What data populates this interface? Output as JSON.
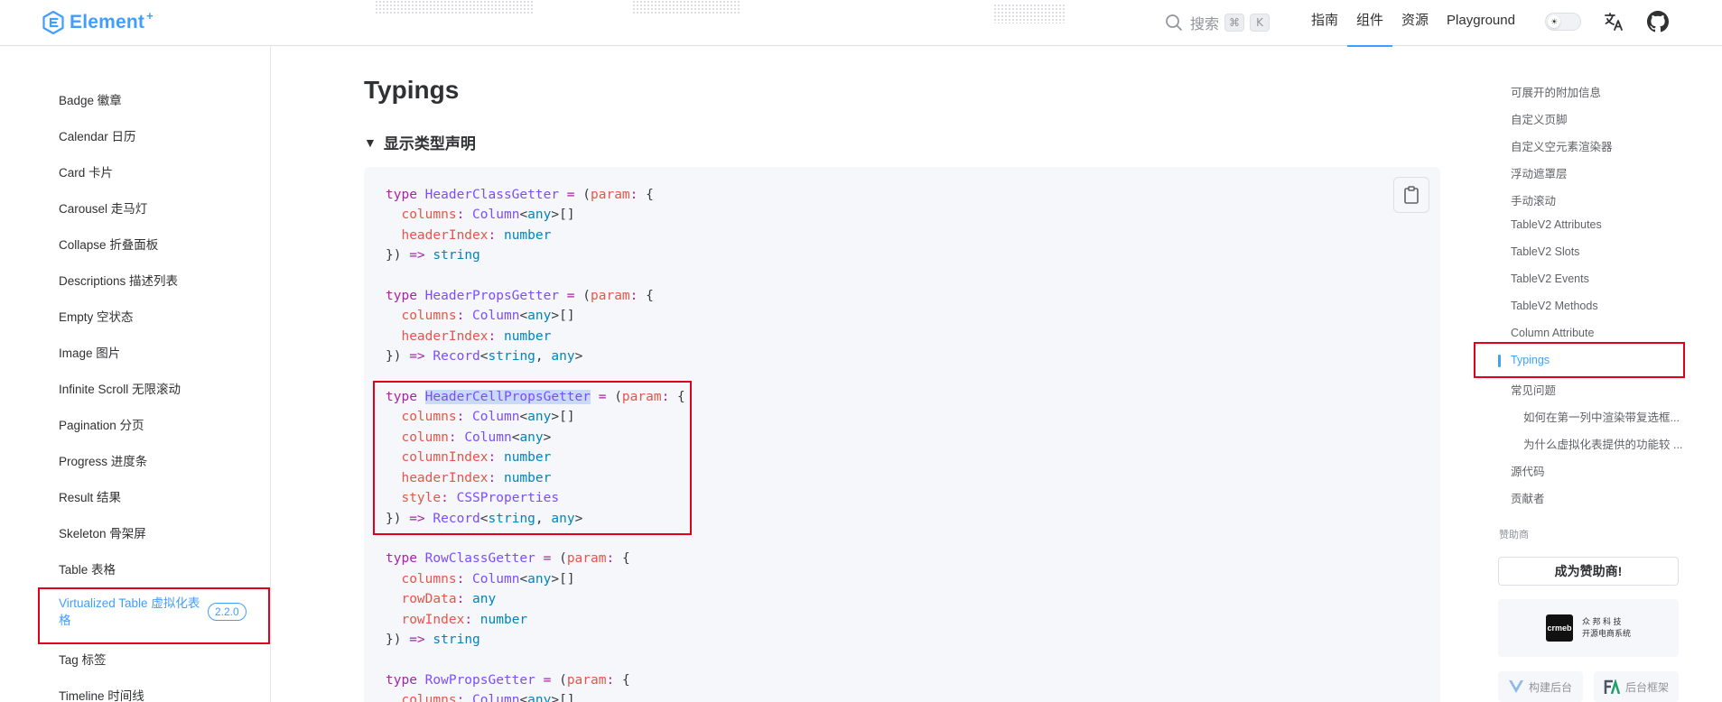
{
  "header": {
    "brand": "Element",
    "brand_plus": "+",
    "search_placeholder": "搜索",
    "kbd_cmd": "⌘",
    "kbd_k": "K",
    "nav": [
      "指南",
      "组件",
      "资源",
      "Playground"
    ],
    "nav_active_index": 1
  },
  "sidebar": {
    "items": [
      "Badge 徽章",
      "Calendar 日历",
      "Card 卡片",
      "Carousel 走马灯",
      "Collapse 折叠面板",
      "Descriptions 描述列表",
      "Empty 空状态",
      "Image 图片",
      "Infinite Scroll 无限滚动",
      "Pagination 分页",
      "Progress 进度条",
      "Result 结果",
      "Skeleton 骨架屏",
      "Table 表格",
      "Virtualized Table 虚拟化表格",
      "Tag 标签",
      "Timeline 时间线"
    ],
    "active_item": "Virtualized Table 虚拟化表格",
    "active_badge": "2.2.0"
  },
  "main": {
    "title": "Typings",
    "summary": "显示类型声明"
  },
  "toc": {
    "items": [
      "可展开的附加信息",
      "自定义页脚",
      "自定义空元素渲染器",
      "浮动遮罩层",
      "手动滚动",
      "TableV2 Attributes",
      "TableV2 Slots",
      "TableV2 Events",
      "TableV2 Methods",
      "Column Attribute",
      "Typings",
      "常见问题",
      "如何在第一列中渲染带复选框...",
      "为什么虚拟化表提供的功能较 ...",
      "源代码",
      "贡献者"
    ],
    "active_item": "Typings",
    "sponsor_label": "赞助商",
    "sponsor_button": "成为赞助商!",
    "sponsor_crmeb_line1": "众 邦 科 技",
    "sponsor_crmeb_line2": "开源电商系统",
    "sponsor_crmeb_logo": "crmeb",
    "sponsor_small_1": "构建后台",
    "sponsor_small_2": "后台框架"
  },
  "colors": {
    "accent": "#409eff",
    "highlight_border": "#e0001b"
  }
}
